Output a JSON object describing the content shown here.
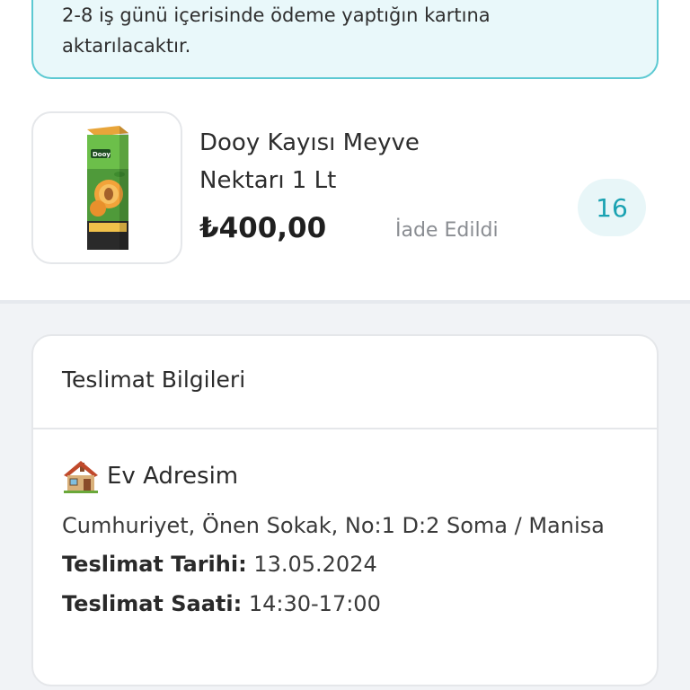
{
  "banner": {
    "line1": "2-8 iş günü içerisinde ödeme yaptığın kartına",
    "line2": "aktarılacaktır."
  },
  "product": {
    "name": "Dooy Kayısı Meyve Nektarı 1 Lt",
    "price": "₺400,00",
    "status": "İade Edildi",
    "quantity": "16",
    "image_icon": "juice-carton-icon"
  },
  "delivery": {
    "title": "Teslimat Bilgileri",
    "address_icon": "house-icon",
    "address_name": "Ev Adresim",
    "address_text": "Cumhuriyet, Önen Sokak, No:1 D:2 Soma / Manisa",
    "date_label": "Teslimat Tarihi:",
    "date_value": "13.05.2024",
    "time_label": "Teslimat Saati:",
    "time_value": "14:30-17:00"
  },
  "colors": {
    "accent": "#5cc9d2",
    "banner_bg": "#e9f8fa",
    "badge_text": "#1aa2b2",
    "page_bg": "#f1f3f6"
  }
}
